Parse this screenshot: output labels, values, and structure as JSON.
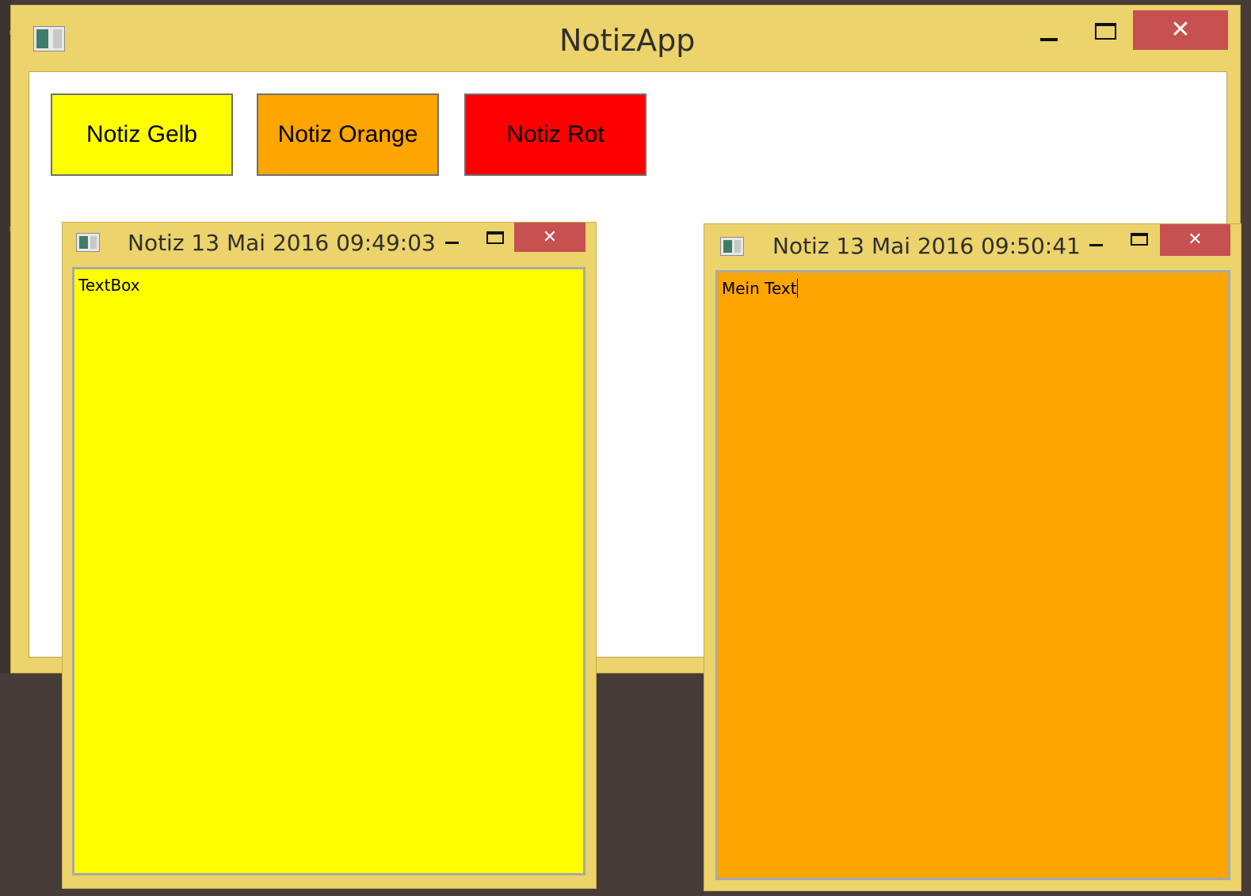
{
  "main_window": {
    "title": "NotizApp",
    "close_glyph": "✕",
    "buttons": [
      {
        "label": "Notiz Gelb",
        "color": "#ffff00"
      },
      {
        "label": "Notiz Orange",
        "color": "#ffa500"
      },
      {
        "label": "Notiz Rot",
        "color": "#ff0000"
      }
    ]
  },
  "note_windows": [
    {
      "title": "Notiz 13 Mai 2016 09:49:03",
      "text": "TextBox",
      "color": "#ffff00",
      "close_glyph": "✕"
    },
    {
      "title": "Notiz 13 Mai 2016 09:50:41",
      "text": "Mein Text",
      "color": "#ffa500",
      "close_glyph": "✕"
    }
  ],
  "icons": {
    "app": "app-icon",
    "minimize": "minimize-icon",
    "maximize": "maximize-icon",
    "close": "close-icon"
  },
  "colors": {
    "frame": "#ecd36b",
    "close_button": "#c75050",
    "desktop": "#483c38"
  }
}
